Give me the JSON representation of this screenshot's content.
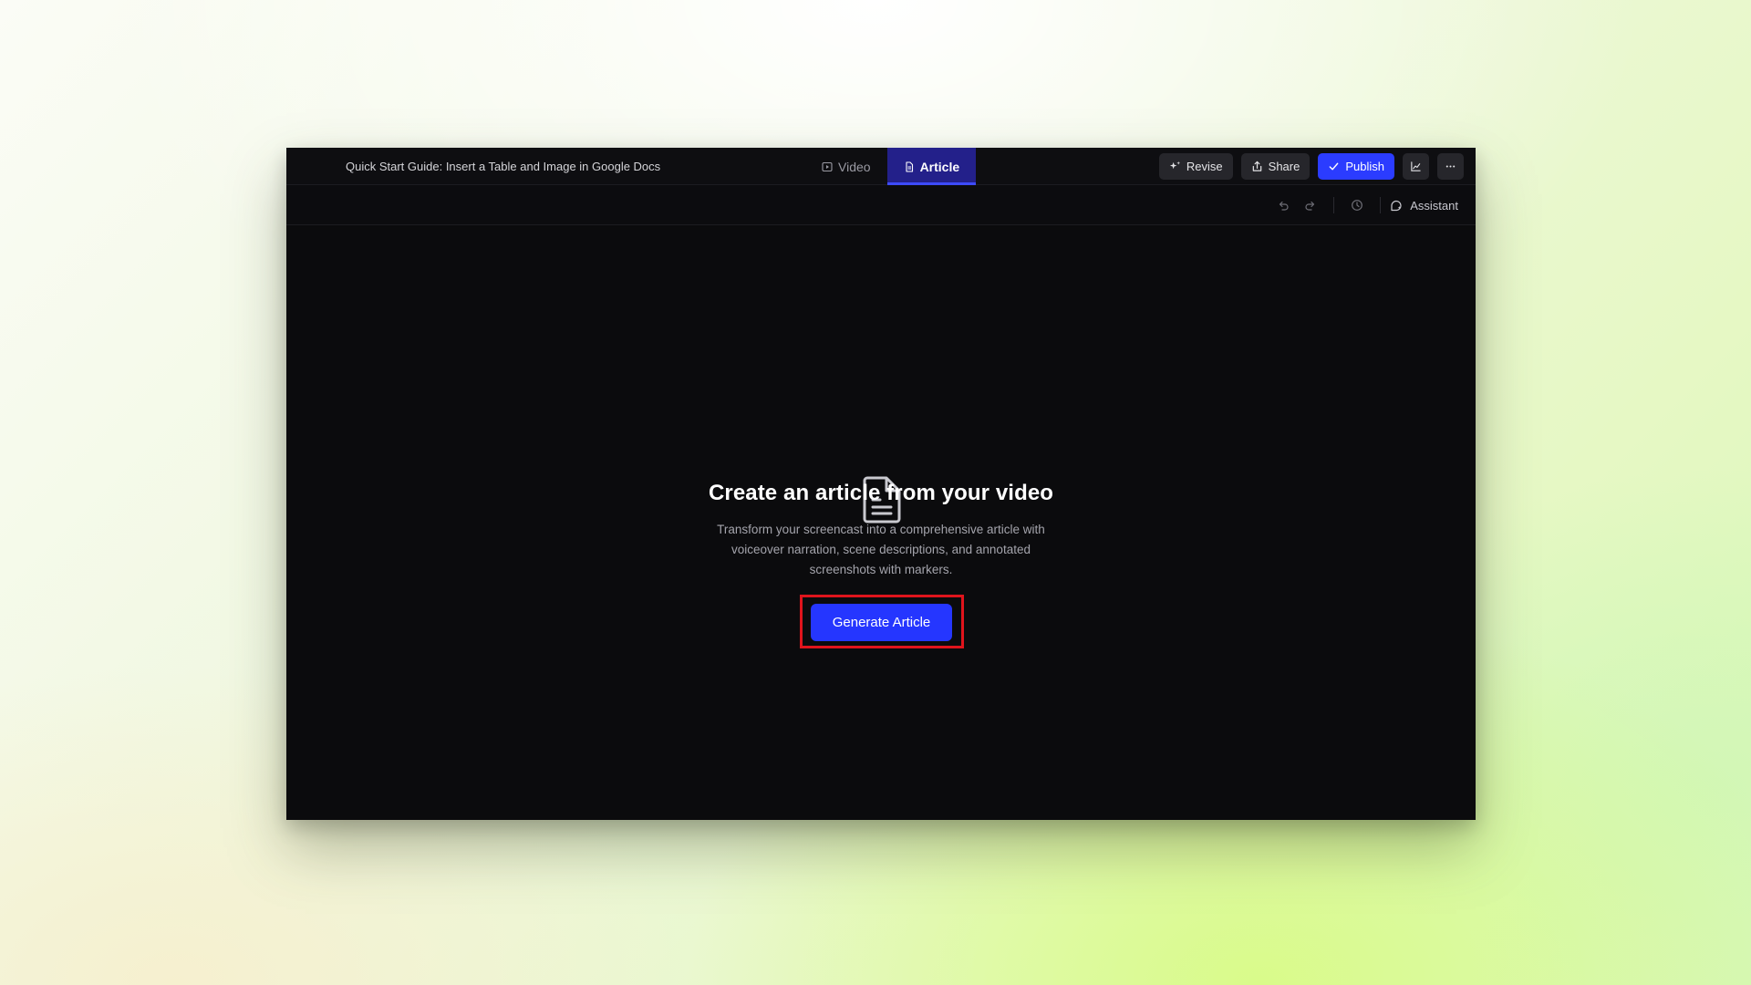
{
  "header": {
    "doc_title": "Quick Start Guide: Insert a Table and Image in Google Docs",
    "tabs": [
      {
        "label": "Video",
        "icon": "play-icon",
        "active": false
      },
      {
        "label": "Article",
        "icon": "document-icon",
        "active": true
      }
    ],
    "actions": {
      "revise_label": "Revise",
      "share_label": "Share",
      "publish_label": "Publish"
    }
  },
  "toolbar": {
    "assistant_label": "Assistant",
    "icons": [
      "undo-icon",
      "redo-icon",
      "history-icon",
      "assistant-icon"
    ]
  },
  "empty_state": {
    "title": "Create an article from your video",
    "description": "Transform your screencast into a comprehensive article with voiceover narration, scene descriptions, and annotated screenshots with markers.",
    "button_label": "Generate Article"
  },
  "colors": {
    "accent": "#2b3cff",
    "active_tab_bg": "#23208a",
    "highlight": "#e0141c",
    "app_bg": "#0b0b0d"
  }
}
